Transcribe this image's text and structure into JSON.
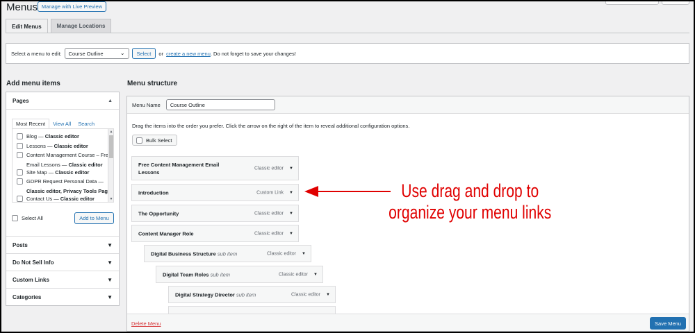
{
  "header": {
    "title": "Menus",
    "live_preview_label": "Manage with Live Preview"
  },
  "tabs": [
    {
      "label": "Edit Menus",
      "active": true
    },
    {
      "label": "Manage Locations",
      "active": false
    }
  ],
  "select_bar": {
    "prompt": "Select a menu to edit:",
    "selected_menu": "Course Outline",
    "select_button": "Select",
    "or_text": "or",
    "create_link": "create a new menu",
    "suffix": ". Do not forget to save your changes!"
  },
  "add_menu_items": {
    "heading": "Add menu items",
    "pages_title": "Pages",
    "inner_tabs": [
      "Most Recent",
      "View All",
      "Search"
    ],
    "pages": [
      {
        "title": "Blog",
        "editor": "Classic editor"
      },
      {
        "title": "Lessons",
        "editor": "Classic editor"
      },
      {
        "title": "Content Management Course – Free Email Lessons",
        "editor": "Classic editor"
      },
      {
        "title": "Site Map",
        "editor": "Classic editor"
      },
      {
        "title": "GDPR Request Personal Data",
        "editor": "Classic editor, Privacy Tools Page"
      },
      {
        "title": "Contact Us",
        "editor": "Classic editor"
      }
    ],
    "select_all_label": "Select All",
    "add_button": "Add to Menu",
    "accordions": [
      "Posts",
      "Do Not Sell Info",
      "Custom Links",
      "Categories"
    ]
  },
  "menu_structure": {
    "heading": "Menu structure",
    "menu_name_label": "Menu Name",
    "menu_name_value": "Course Outline",
    "instructions": "Drag the items into the order you prefer. Click the arrow on the right of the item to reveal additional configuration options.",
    "bulk_select_label": "Bulk Select",
    "items": [
      {
        "title": "Free Content Management Email Lessons",
        "sub": "",
        "type": "Classic editor",
        "depth": 0
      },
      {
        "title": "Introduction",
        "sub": "",
        "type": "Custom Link",
        "depth": 0
      },
      {
        "title": "The Opportunity",
        "sub": "",
        "type": "Classic editor",
        "depth": 0
      },
      {
        "title": "Content Manager Role",
        "sub": "",
        "type": "Classic editor",
        "depth": 0
      },
      {
        "title": "Digital Business Structure",
        "sub": "sub item",
        "type": "Classic editor",
        "depth": 1
      },
      {
        "title": "Digital Team Roles",
        "sub": "sub item",
        "type": "Classic editor",
        "depth": 2
      },
      {
        "title": "Digital Strategy Director",
        "sub": "sub item",
        "type": "Classic editor",
        "depth": 3
      }
    ],
    "delete_label": "Delete Menu",
    "save_label": "Save Menu"
  },
  "annotation": {
    "line1": "Use drag and drop to",
    "line2": "organize your menu links",
    "color": "#e00000"
  },
  "colors": {
    "accent": "#2271b1",
    "danger": "#d63638",
    "background": "#f0f0f1"
  }
}
